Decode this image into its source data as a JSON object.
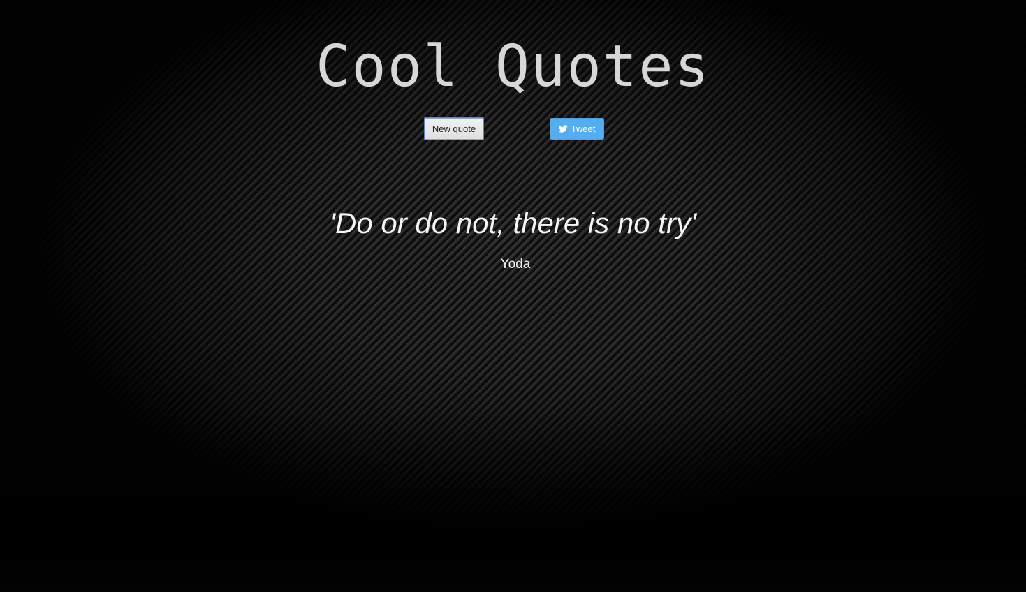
{
  "header": {
    "title": "Cool Quotes"
  },
  "actions": {
    "new_quote_label": "New quote",
    "tweet_label": "Tweet",
    "tweet_icon": "twitter-bird-icon",
    "tweet_color": "#55acee"
  },
  "quote": {
    "text": "'Do or do not, there is no try'",
    "author": "Yoda"
  },
  "theme": {
    "background": "#050505",
    "title_color": "#d7d7d7",
    "text_color": "#f5f5f5"
  }
}
